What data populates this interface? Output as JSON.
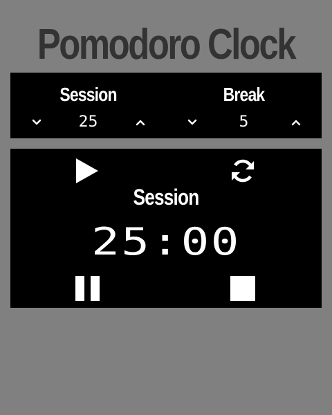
{
  "app": {
    "title": "Pomodoro Clock"
  },
  "settings": {
    "session": {
      "label": "Session",
      "value": "25",
      "decrement_icon": "chevron-down-icon",
      "increment_icon": "chevron-up-icon"
    },
    "break": {
      "label": "Break",
      "value": "5",
      "decrement_icon": "chevron-down-icon",
      "increment_icon": "chevron-up-icon"
    }
  },
  "timer": {
    "label": "Session",
    "display": "25:00",
    "controls": {
      "play_icon": "play-icon",
      "reset_icon": "refresh-icon",
      "pause_icon": "pause-icon",
      "stop_icon": "stop-icon"
    }
  },
  "colors": {
    "background": "#808080",
    "panel": "#000000",
    "title": "#333333",
    "foreground": "#ffffff"
  }
}
